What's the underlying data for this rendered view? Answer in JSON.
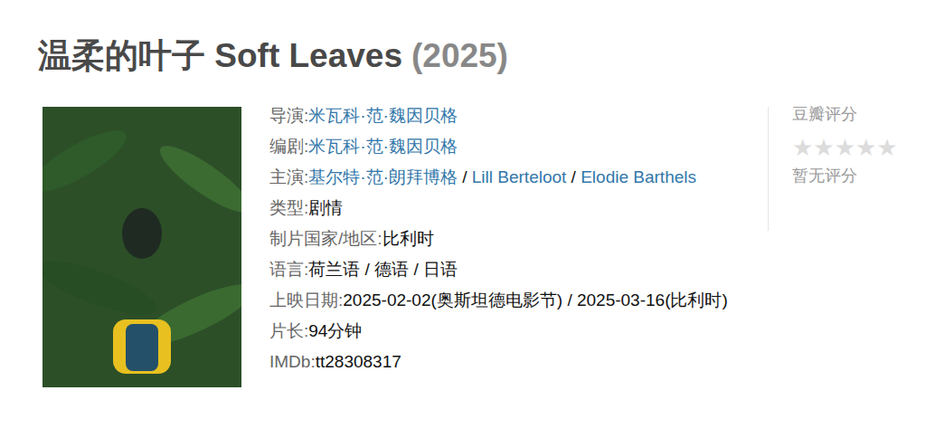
{
  "page": {
    "title": "温柔的叶子 Soft Leaves",
    "year": "(2025)"
  },
  "info": [
    {
      "label": "导演:",
      "separator": " / ",
      "values": [
        {
          "text": "米瓦科·范·魏因贝格",
          "link": true
        }
      ]
    },
    {
      "label": "编剧:",
      "separator": " / ",
      "values": [
        {
          "text": "米瓦科·范·魏因贝格",
          "link": true
        }
      ]
    },
    {
      "label": "主演:",
      "separator": " / ",
      "values": [
        {
          "text": "基尔特·范·朗拜博格",
          "link": true
        },
        {
          "text": "Lill Berteloot",
          "link": true
        },
        {
          "text": "Elodie Barthels",
          "link": true
        }
      ]
    },
    {
      "label": "类型:",
      "separator": " / ",
      "values": [
        {
          "text": "剧情",
          "link": false
        }
      ]
    },
    {
      "label": "制片国家/地区:",
      "separator": " / ",
      "values": [
        {
          "text": "比利时",
          "link": false
        }
      ]
    },
    {
      "label": "语言:",
      "separator": " / ",
      "values": [
        {
          "text": "荷兰语 / 德语 / 日语",
          "link": false
        }
      ]
    },
    {
      "label": "上映日期:",
      "separator": " / ",
      "values": [
        {
          "text": "2025-02-02(奥斯坦德电影节) / 2025-03-16(比利时)",
          "link": false
        }
      ]
    },
    {
      "label": "片长:",
      "separator": " / ",
      "values": [
        {
          "text": "94分钟",
          "link": false
        }
      ]
    },
    {
      "label": "IMDb:",
      "separator": " / ",
      "values": [
        {
          "text": "tt28308317",
          "link": false
        }
      ]
    }
  ],
  "rating": {
    "label": "豆瓣评分",
    "stars": 0,
    "max": 5,
    "star_glyph": "★",
    "status": "暂无评分"
  }
}
